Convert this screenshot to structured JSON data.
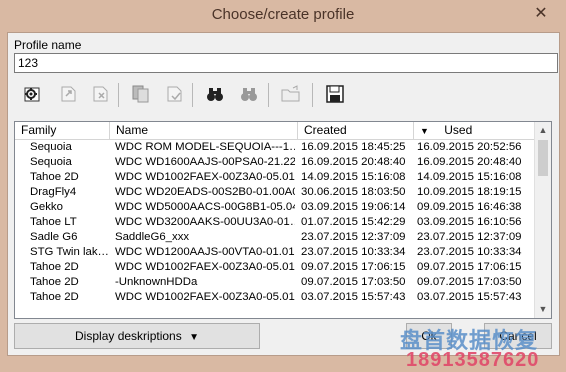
{
  "window": {
    "title": "Choose/create profile",
    "close_glyph": "✕"
  },
  "profile": {
    "label": "Profile name",
    "value": "123"
  },
  "toolbar": {
    "buttons": [
      {
        "icon": "gear-settings-icon"
      },
      {
        "icon": "export-icon"
      },
      {
        "icon": "delete-icon"
      },
      {
        "icon": "copy-icon"
      },
      {
        "icon": "apply-icon"
      },
      {
        "icon": "binoculars-icon"
      },
      {
        "icon": "binoculars-disabled-icon"
      },
      {
        "icon": "folder-open-icon"
      },
      {
        "icon": "save-icon"
      }
    ]
  },
  "table": {
    "columns": [
      "Family",
      "Name",
      "Created",
      "Used"
    ],
    "sort_indicator": "▼",
    "rows": [
      [
        "Sequoia",
        "WDC ROM MODEL-SEQUOIA---1…",
        "16.09.2015 18:45:25",
        "16.09.2015 20:52:56"
      ],
      [
        "Sequoia",
        "WDC WD1600AAJS-00PSA0-21.22…",
        "16.09.2015 20:48:40",
        "16.09.2015 20:48:40"
      ],
      [
        "Tahoe 2D",
        "WDC WD1002FAEX-00Z3A0-05.01…",
        "14.09.2015 15:16:08",
        "14.09.2015 15:16:08"
      ],
      [
        "DragFly4",
        "WDC WD20EADS-00S2B0-01.00A0…",
        "30.06.2015 18:03:50",
        "10.09.2015 18:19:15"
      ],
      [
        "Gekko",
        "WDC WD5000AACS-00G8B1-05.04…",
        "03.09.2015 19:06:14",
        "09.09.2015 16:46:38"
      ],
      [
        "Tahoe LT",
        "WDC WD3200AAKS-00UU3A0-01…",
        "01.07.2015 15:42:29",
        "03.09.2015 16:10:56"
      ],
      [
        "Sadle G6",
        "SaddleG6_xxx",
        "23.07.2015 12:37:09",
        "23.07.2015 12:37:09"
      ],
      [
        "STG Twin lak…",
        "WDC WD1200AAJS-00VTA0-01.01…",
        "23.07.2015 10:33:34",
        "23.07.2015 10:33:34"
      ],
      [
        "Tahoe 2D",
        "WDC WD1002FAEX-00Z3A0-05.01…",
        "09.07.2015 17:06:15",
        "09.07.2015 17:06:15"
      ],
      [
        "Tahoe 2D",
        "-UnknownHDDa",
        "09.07.2015 17:03:50",
        "09.07.2015 17:03:50"
      ],
      [
        "Tahoe 2D",
        "WDC WD1002FAEX-00Z3A0-05.01…",
        "03.07.2015 15:57:43",
        "03.07.2015 15:57:43"
      ]
    ]
  },
  "buttons": {
    "display_descriptions": "Display deskriptions",
    "dropdown_glyph": "▼",
    "ok": "Ok",
    "cancel": "Cancel"
  },
  "scrollbar": {
    "up_glyph": "▲",
    "down_glyph": "▼"
  },
  "watermark": {
    "line1": "盘首数据恢复",
    "line2": "18913587620"
  }
}
